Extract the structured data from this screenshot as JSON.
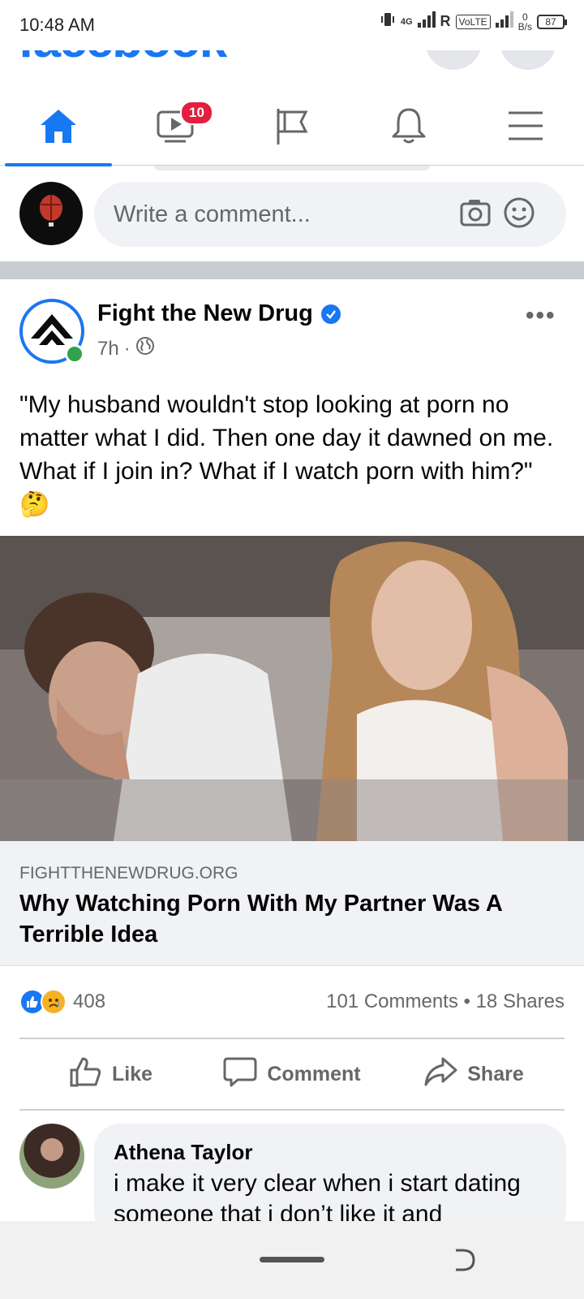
{
  "status_bar": {
    "time": "10:48 AM",
    "network": "4G",
    "roaming": "R",
    "volte": "VoLTE",
    "speed_value": "0",
    "speed_unit": "B/s",
    "battery": "87"
  },
  "header": {
    "logo": "facebook"
  },
  "nav": {
    "tabs": [
      {
        "name": "home",
        "active": true
      },
      {
        "name": "watch",
        "badge": "10"
      },
      {
        "name": "pages"
      },
      {
        "name": "notifications"
      },
      {
        "name": "menu"
      }
    ]
  },
  "comment_bar": {
    "placeholder": "Write a comment..."
  },
  "post": {
    "author": "Fight the New Drug",
    "time": "7h",
    "separator": "·",
    "text": "\"My husband wouldn't stop looking at porn no matter what I did. Then one day it dawned on me. What if I join in? What if I watch porn with him?\" 🤔",
    "link": {
      "domain": "FIGHTTHENEWDRUG.ORG",
      "title": "Why Watching Porn With My Partner Was A Terrible Idea"
    },
    "reactions_count": "408",
    "stats": "101 Comments • 18 Shares",
    "actions": {
      "like": "Like",
      "comment": "Comment",
      "share": "Share"
    }
  },
  "comment": {
    "author": "Athena Taylor",
    "text": "i make it very clear when i start dating someone that i don’t like it and"
  },
  "colors": {
    "brand": "#1877f2",
    "badge": "#e41e3f",
    "online": "#31a24c",
    "secondary_text": "#65676b"
  }
}
